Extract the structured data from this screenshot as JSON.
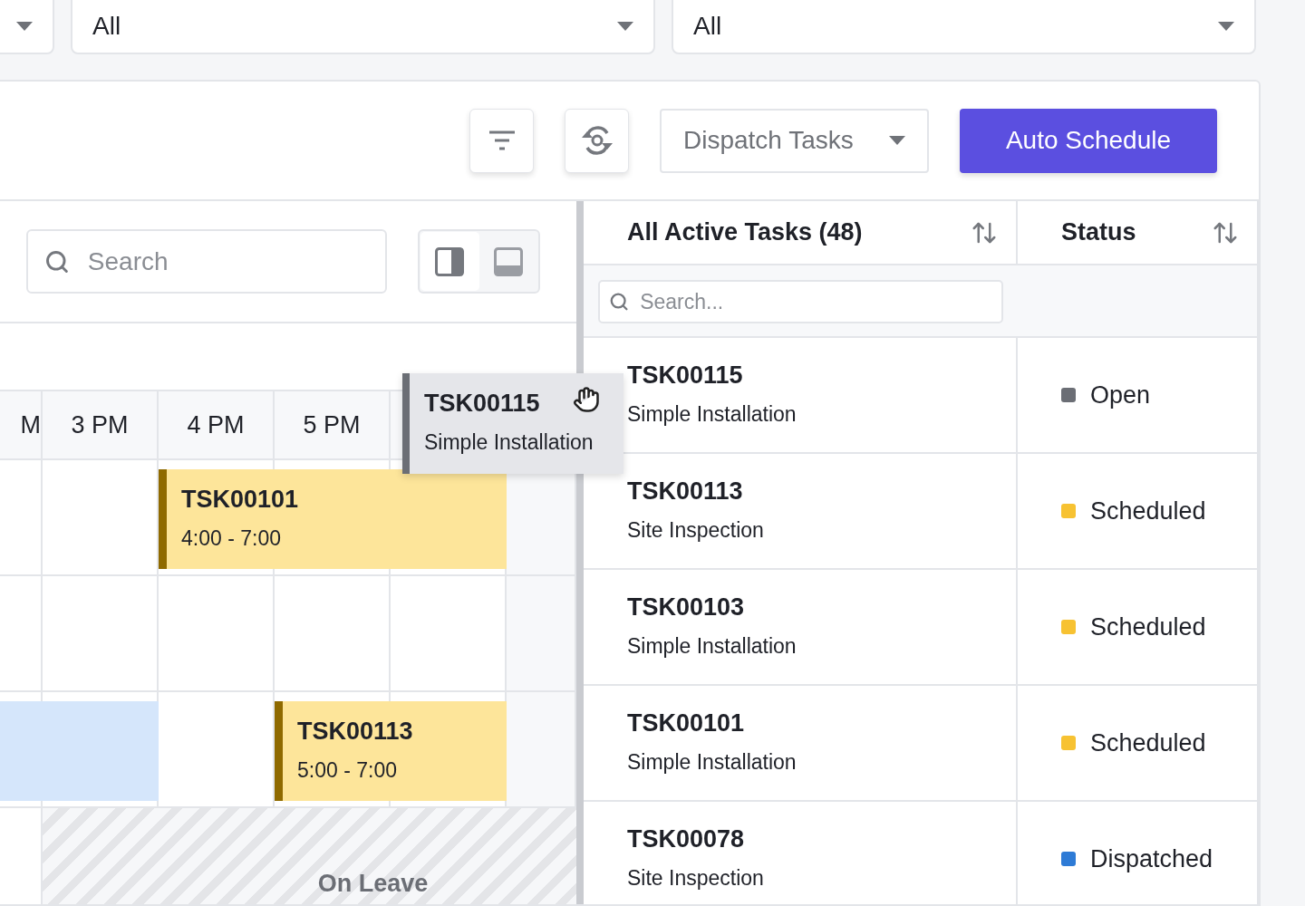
{
  "filters": [
    {
      "value": "All"
    },
    {
      "value": "All"
    }
  ],
  "toolbar": {
    "view_dropdown": "Dispatch Tasks",
    "auto_schedule": "Auto Schedule"
  },
  "calendar": {
    "search_placeholder": "Search",
    "view_toggle": [
      {
        "selected": true
      },
      {
        "selected": false
      }
    ],
    "hours": [
      "M",
      "3 PM",
      "4 PM",
      "5 PM"
    ],
    "lanes": [
      {
        "kind": "busy",
        "events": [
          {
            "kind": "task",
            "title": "TSK00101",
            "time": "4:00 - 7:00"
          }
        ]
      },
      {
        "kind": "empty"
      },
      {
        "kind": "busy",
        "events": [
          {
            "kind": "block"
          },
          {
            "kind": "task",
            "title": "TSK00113",
            "time": "5:00 - 7:00"
          }
        ]
      },
      {
        "kind": "busy",
        "events": [
          {
            "kind": "leave",
            "label": "On Leave"
          }
        ]
      }
    ]
  },
  "drag_card": {
    "title": "TSK00115",
    "subtitle": "Simple Installation"
  },
  "tasks": {
    "title": "All Active Tasks (48)",
    "status_title": "Status",
    "search_placeholder": "Search...",
    "rows": [
      {
        "code": "TSK00115",
        "name": "Simple Installation",
        "status": "Open",
        "color": "#6b6e75"
      },
      {
        "code": "TSK00113",
        "name": "Site Inspection",
        "status": "Scheduled",
        "color": "#f7c232"
      },
      {
        "code": "TSK00103",
        "name": "Simple Installation",
        "status": "Scheduled",
        "color": "#f7c232"
      },
      {
        "code": "TSK00101",
        "name": "Simple Installation",
        "status": "Scheduled",
        "color": "#f7c232"
      },
      {
        "code": "TSK00078",
        "name": "Site Inspection",
        "status": "Dispatched",
        "color": "#2e7bd6"
      }
    ]
  }
}
